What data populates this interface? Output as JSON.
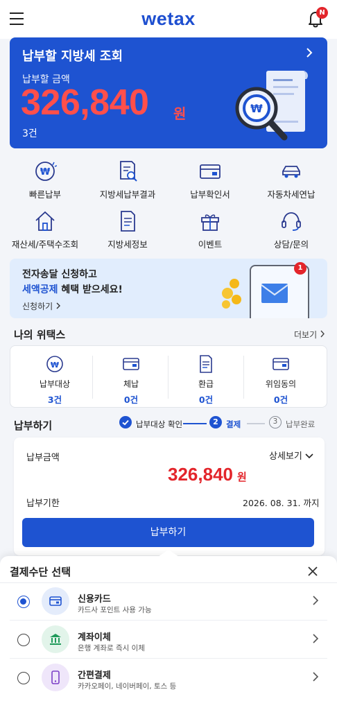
{
  "header": {
    "logo": "wetax",
    "notification_badge": "N"
  },
  "hero": {
    "title": "납부할 지방세 조회",
    "amount_label": "납부할 금액",
    "amount": "326,840",
    "unit": "원",
    "count": "3건"
  },
  "quick_menu": [
    {
      "label": "빠른납부",
      "icon": "won-coin-icon"
    },
    {
      "label": "지방세납부결과",
      "icon": "document-search-icon"
    },
    {
      "label": "납부확인서",
      "icon": "card-icon"
    },
    {
      "label": "자동차세연납",
      "icon": "car-icon"
    },
    {
      "label": "재산세/주택수조회",
      "icon": "house-icon"
    },
    {
      "label": "지방세정보",
      "icon": "document-icon"
    },
    {
      "label": "이벤트",
      "icon": "gift-icon"
    },
    {
      "label": "상담/문의",
      "icon": "headset-icon"
    }
  ],
  "banner": {
    "line1": "전자송달 신청하고",
    "highlight": "세액공제",
    "line2_rest": " 혜택 받으세요!",
    "link": "신청하기",
    "badge": "1"
  },
  "my_wetax": {
    "title": "나의 위택스",
    "more": "더보기",
    "items": [
      {
        "label": "납부대상",
        "value": "3건"
      },
      {
        "label": "체납",
        "value": "0건"
      },
      {
        "label": "환급",
        "value": "0건"
      },
      {
        "label": "위임동의",
        "value": "0건"
      }
    ]
  },
  "payment": {
    "title": "납부하기",
    "steps": [
      {
        "num": "",
        "label": "납부대상 확인",
        "state": "done"
      },
      {
        "num": "2",
        "label": "결제",
        "state": "current"
      },
      {
        "num": "3",
        "label": "납부완료",
        "state": "pending"
      }
    ],
    "amount_label": "납부금액",
    "detail": "상세보기",
    "amount": "326,840",
    "unit": "원",
    "due_label": "납부기한",
    "due_date": "2026. 08. 31. 까지",
    "button": "납부하기"
  },
  "sheet": {
    "title": "결제수단 선택",
    "options": [
      {
        "name": "신용카드",
        "desc": "카드사 포인트 사용 가능",
        "selected": true,
        "icon": "credit-card-icon"
      },
      {
        "name": "계좌이체",
        "desc": "은행 계좌로 즉시 이체",
        "selected": false,
        "icon": "bank-icon"
      },
      {
        "name": "간편결제",
        "desc": "카카오페이, 네이버페이, 토스 등",
        "selected": false,
        "icon": "mobile-phone-icon"
      }
    ]
  },
  "colors": {
    "primary": "#1e53d1",
    "accent_red": "#e3252b",
    "hero_amount": "#ff4f4b",
    "banner_bg": "#e1edfd"
  }
}
